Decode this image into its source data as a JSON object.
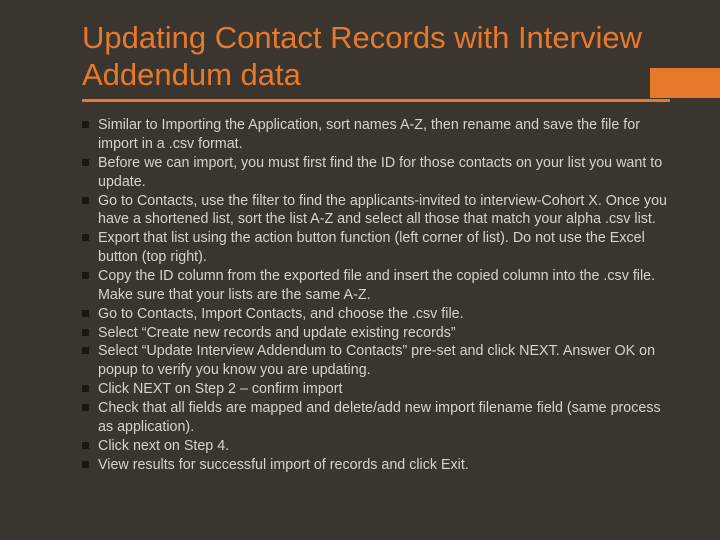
{
  "title": "Updating Contact Records with Interview Addendum data",
  "bullets": [
    "Similar to Importing the Application, sort names A-Z, then rename and save the file for import in a .csv format.",
    "Before we can import, you must first find the ID for those contacts on your list you want to update.",
    "Go to Contacts, use the filter to find the applicants-invited to interview-Cohort X.  Once you have a shortened list, sort the list A-Z and select all those that match your alpha .csv list.",
    "Export that list using the action button function (left corner of list).  Do not use the Excel button (top right).",
    "Copy the ID column from the exported file and insert the copied column into the .csv file.  Make sure that your lists are the same A-Z.",
    "Go to Contacts, Import Contacts, and choose the .csv file.",
    "Select “Create new records and update existing records”",
    "Select “Update Interview Addendum to Contacts” pre-set and click NEXT.  Answer OK on popup to verify you know you are updating.",
    "Click NEXT on Step 2 – confirm import",
    "Check that all fields are mapped and delete/add new import filename field (same process as application).",
    "Click next on Step 4.",
    "View results for successful import of records and click Exit."
  ]
}
